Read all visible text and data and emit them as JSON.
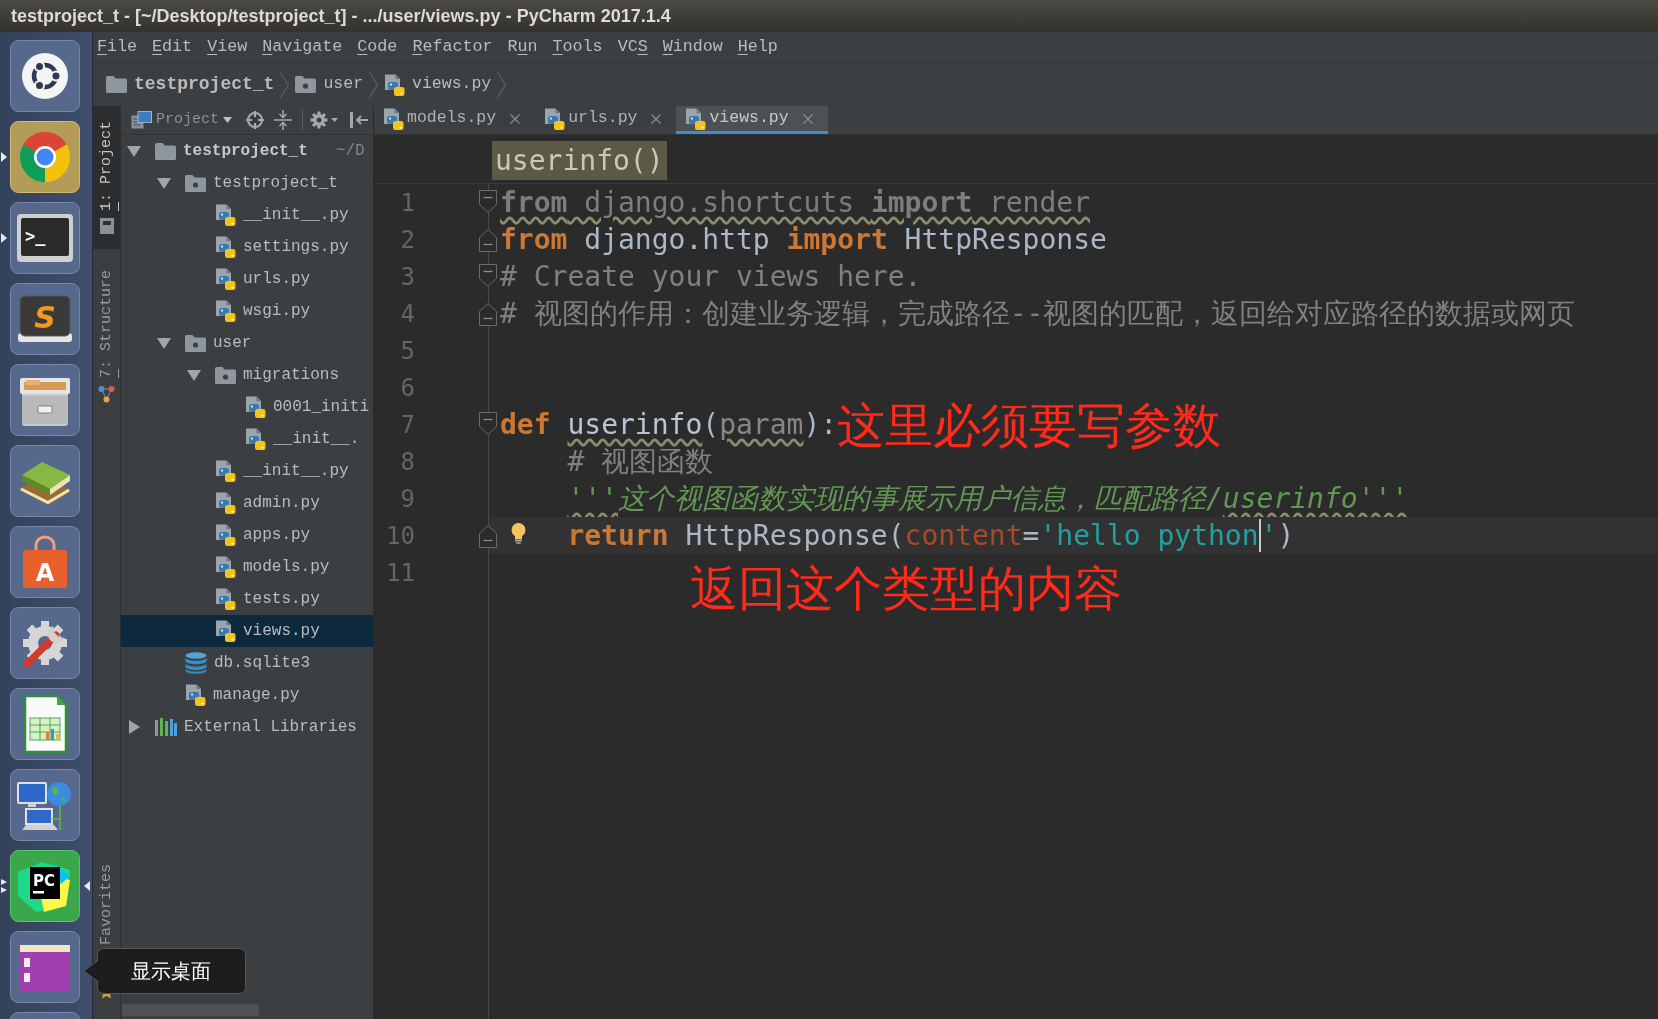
{
  "window": {
    "title": "testproject_t - [~/Desktop/testproject_t] - .../user/views.py - PyCharm 2017.1.4"
  },
  "launcher": {
    "items": [
      {
        "kind": "dash",
        "running": false,
        "focused": false
      },
      {
        "kind": "browser",
        "running": true,
        "focused": false
      },
      {
        "kind": "terminal",
        "glyph": ">_",
        "running": true,
        "focused": false
      },
      {
        "kind": "text_editor",
        "glyph": "S",
        "running": false,
        "focused": false
      },
      {
        "kind": "files",
        "running": false,
        "focused": false
      },
      {
        "kind": "reader",
        "running": false,
        "focused": false
      },
      {
        "kind": "software",
        "glyph": "A",
        "running": false,
        "focused": false
      },
      {
        "kind": "settings",
        "running": false,
        "focused": false
      },
      {
        "kind": "spreadsheet",
        "running": false,
        "focused": false
      },
      {
        "kind": "network",
        "running": false,
        "focused": false
      },
      {
        "kind": "ide",
        "glyph": "PC",
        "running": true,
        "focused": true
      },
      {
        "kind": "workspace",
        "running": false,
        "focused": false,
        "tooltip": "显示桌面"
      },
      {
        "kind": "partial",
        "running": false,
        "focused": false
      }
    ]
  },
  "menu": [
    {
      "label": "File",
      "mnemonic": {
        "kind": "first"
      }
    },
    {
      "label": "Edit",
      "mnemonic": {
        "kind": "first"
      }
    },
    {
      "label": "View",
      "mnemonic": {
        "kind": "first"
      }
    },
    {
      "label": "Navigate",
      "mnemonic": {
        "kind": "first"
      }
    },
    {
      "label": "Code",
      "mnemonic": {
        "kind": "first"
      }
    },
    {
      "label": "Refactor",
      "mnemonic": {
        "kind": "first"
      }
    },
    {
      "label": "Run",
      "mnemonic": {
        "kind": "second"
      }
    },
    {
      "label": "Tools",
      "mnemonic": {
        "kind": "first"
      }
    },
    {
      "label": "VCS",
      "mnemonic": {
        "kind": "last"
      }
    },
    {
      "label": "Window",
      "mnemonic": {
        "kind": "first"
      }
    },
    {
      "label": "Help",
      "mnemonic": {
        "kind": "first"
      }
    }
  ],
  "navigation_bar": [
    {
      "kind": "folder",
      "label": "testproject_t"
    },
    {
      "kind": "package",
      "label": "user"
    },
    {
      "kind": "python",
      "label": "views.py"
    }
  ],
  "tool_strip": {
    "top": [
      {
        "kind": "project",
        "label": "1: Project",
        "mnemonic": {
          "kind": "first"
        },
        "selected": true
      },
      {
        "kind": "structure",
        "label": "7: Structure",
        "mnemonic": {
          "kind": "first"
        },
        "selected": false
      }
    ],
    "bottom": [
      {
        "kind": "favorites",
        "label": "Favorites",
        "selected": false
      }
    ]
  },
  "project_panel": {
    "title": "Project",
    "tree": [
      {
        "kind": "folder",
        "label": "testproject_t",
        "path": "~/D",
        "expanded": true,
        "selected": false,
        "children": [
          {
            "kind": "package",
            "label": "testproject_t",
            "expanded": true,
            "selected": false,
            "children": [
              {
                "kind": "python",
                "label": "__init__.py",
                "selected": false
              },
              {
                "kind": "python",
                "label": "settings.py",
                "selected": false
              },
              {
                "kind": "python",
                "label": "urls.py",
                "selected": false
              },
              {
                "kind": "python",
                "label": "wsgi.py",
                "selected": false
              }
            ]
          },
          {
            "kind": "package",
            "label": "user",
            "expanded": true,
            "selected": false,
            "children": [
              {
                "kind": "package",
                "label": "migrations",
                "expanded": true,
                "selected": false,
                "children": [
                  {
                    "kind": "python",
                    "label": "0001_initi",
                    "selected": false
                  },
                  {
                    "kind": "python",
                    "label": "__init__.",
                    "selected": false
                  }
                ]
              },
              {
                "kind": "python",
                "label": "__init__.py",
                "selected": false
              },
              {
                "kind": "python",
                "label": "admin.py",
                "selected": false
              },
              {
                "kind": "python",
                "label": "apps.py",
                "selected": false
              },
              {
                "kind": "python",
                "label": "models.py",
                "selected": false
              },
              {
                "kind": "python",
                "label": "tests.py",
                "selected": false
              },
              {
                "kind": "python",
                "label": "views.py",
                "selected": true
              }
            ]
          },
          {
            "kind": "database",
            "label": "db.sqlite3",
            "selected": false
          },
          {
            "kind": "python",
            "label": "manage.py",
            "selected": false
          }
        ]
      },
      {
        "kind": "library",
        "label": "External Libraries",
        "expanded": false,
        "selected": false
      }
    ]
  },
  "editor": {
    "tabs": [
      {
        "label": "models.py",
        "selected": false
      },
      {
        "label": "urls.py",
        "selected": false
      },
      {
        "label": "views.py",
        "selected": true
      }
    ],
    "breadcrumb": "userinfo()",
    "lines": [
      {
        "number": "1",
        "fold": {
          "kind": "start"
        },
        "greyed": true,
        "indent": false,
        "current": false,
        "bulb": false,
        "tokens": [
          {
            "kind": "keyword",
            "text": "from",
            "warning": true
          },
          {
            "kind": "text",
            "text": " django.shortcuts ",
            "warning": true
          },
          {
            "kind": "keyword",
            "text": "import",
            "warning": true
          },
          {
            "kind": "text",
            "text": " render",
            "warning": true
          }
        ]
      },
      {
        "number": "2",
        "fold": {
          "kind": "end"
        },
        "greyed": false,
        "indent": false,
        "current": false,
        "bulb": false,
        "tokens": [
          {
            "kind": "keyword",
            "text": "from",
            "warning": false
          },
          {
            "kind": "text",
            "text": " django.http ",
            "warning": false
          },
          {
            "kind": "keyword",
            "text": "import",
            "warning": false
          },
          {
            "kind": "text",
            "text": " HttpResponse",
            "warning": false
          }
        ]
      },
      {
        "number": "3",
        "fold": {
          "kind": "start"
        },
        "indent": false,
        "current": false,
        "bulb": false,
        "tokens": [
          {
            "kind": "comment",
            "text": "# Create your views here.",
            "warning": false
          }
        ]
      },
      {
        "number": "4",
        "fold": {
          "kind": "end"
        },
        "indent": false,
        "current": false,
        "bulb": false,
        "tokens": [
          {
            "kind": "comment",
            "text": "# 视图的作用：创建业务逻辑，完成路径--视图的匹配，返回给对应路径的数据或网页",
            "warning": false
          }
        ]
      },
      {
        "number": "5",
        "current": false,
        "bulb": false
      },
      {
        "number": "6",
        "current": false,
        "bulb": false
      },
      {
        "number": "7",
        "fold": {
          "kind": "start"
        },
        "greyed": false,
        "indent": false,
        "current": false,
        "bulb": false,
        "tokens": [
          {
            "kind": "keyword",
            "text": "def ",
            "warning": false
          },
          {
            "kind": "function",
            "text": "userinfo",
            "warning": true
          },
          {
            "kind": "text",
            "text": "(",
            "warning": false
          },
          {
            "kind": "param",
            "text": "param",
            "warning": true
          },
          {
            "kind": "text",
            "text": "):",
            "warning": false
          }
        ],
        "note": "这里必须要写参数"
      },
      {
        "number": "8",
        "indent": true,
        "current": false,
        "bulb": false,
        "tokens": [
          {
            "kind": "comment",
            "text": "# 视图函数",
            "warning": false
          }
        ]
      },
      {
        "number": "9",
        "greyed": false,
        "indent": true,
        "current": false,
        "bulb": false,
        "tokens": [
          {
            "kind": "docstring",
            "text": "'''",
            "warning": true
          },
          {
            "kind": "docstring",
            "text": "这个视图函数实现的事展示用户信息，匹配路径/",
            "warning": false
          },
          {
            "kind": "docstring",
            "text": "userinfo'''",
            "warning": true
          }
        ]
      },
      {
        "number": "10",
        "fold": {
          "kind": "end"
        },
        "greyed": false,
        "indent": true,
        "current": true,
        "bulb": true,
        "tokens": [
          {
            "kind": "keyword",
            "text": "return",
            "warning": false
          },
          {
            "kind": "text",
            "text": " HttpResponse(",
            "warning": false
          },
          {
            "kind": "named_arg",
            "text": "content",
            "warning": false
          },
          {
            "kind": "text",
            "text": "=",
            "warning": false
          },
          {
            "kind": "string",
            "text": "'hello python",
            "warning": false,
            "caret": true
          },
          {
            "kind": "string",
            "text": "'",
            "warning": false
          },
          {
            "kind": "text",
            "text": ")",
            "warning": false
          }
        ]
      },
      {
        "number": "11",
        "current": false,
        "bulb": false,
        "note": "返回这个类型的内容"
      }
    ]
  }
}
